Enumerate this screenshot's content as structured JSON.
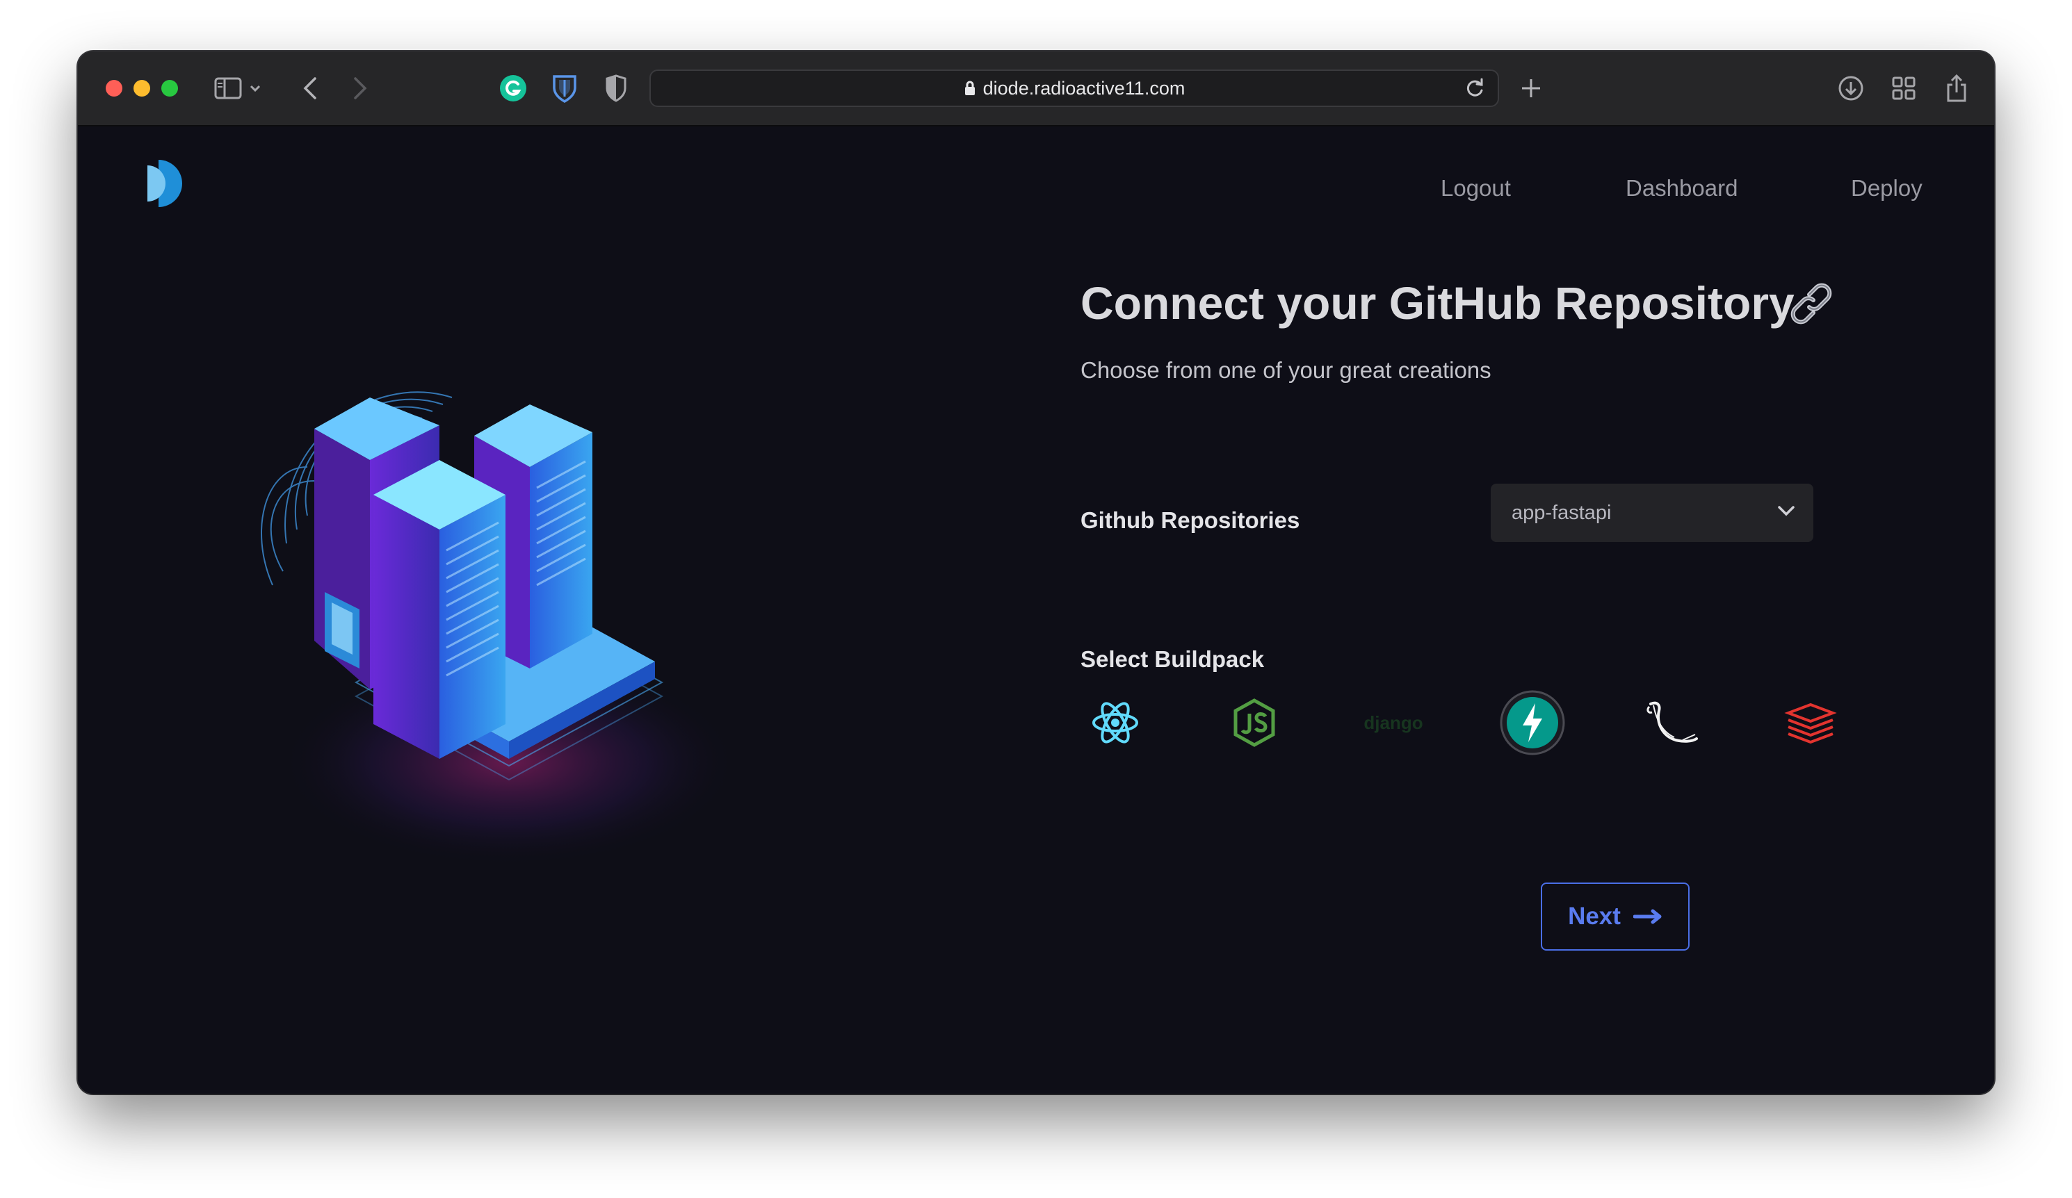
{
  "browser": {
    "url": "diode.radioactive11.com",
    "traffic_lights": {
      "close": "#ff5f57",
      "minimize": "#febc2e",
      "zoom": "#28c840"
    }
  },
  "nav": {
    "links": [
      "Logout",
      "Dashboard",
      "Deploy"
    ]
  },
  "main": {
    "title": "Connect your GitHub Repository",
    "title_emoji": "🔗",
    "subtitle": "Choose from one of your great creations",
    "repo_label": "Github Repositories",
    "repo_selected": "app-fastapi",
    "buildpack_label": "Select Buildpack",
    "buildpacks": [
      {
        "name": "react",
        "icon": "react-icon"
      },
      {
        "name": "nodejs",
        "icon": "nodejs-icon"
      },
      {
        "name": "django",
        "icon": "django-icon",
        "text": "django"
      },
      {
        "name": "fastapi",
        "icon": "fastapi-icon",
        "selected": true
      },
      {
        "name": "flask",
        "icon": "flask-icon"
      },
      {
        "name": "laravel",
        "icon": "laravel-icon"
      }
    ],
    "next_label": "Next"
  },
  "colors": {
    "background": "#0e0e17",
    "accent": "#4a6ee6",
    "react": "#61dafb",
    "node": "#539e43",
    "fastapi": "#05998b",
    "laravel": "#e3342f"
  }
}
